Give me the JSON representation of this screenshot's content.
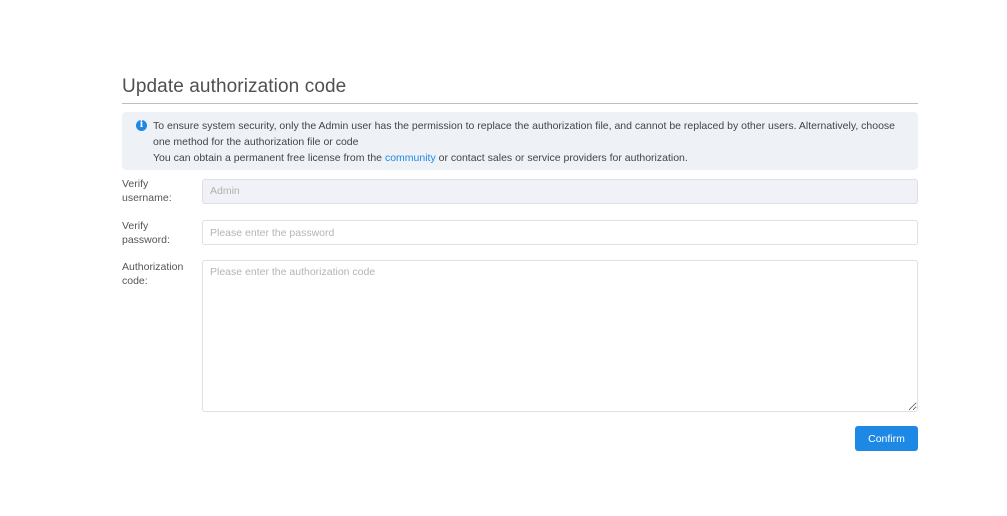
{
  "page": {
    "title": "Update authorization code"
  },
  "notice": {
    "icon": "info-icon",
    "line1": "To ensure system security, only the Admin user has the permission to replace the authorization file, and cannot be replaced by other users. Alternatively, choose one method for the authorization file or code",
    "line2_before": "You can obtain a permanent free license from the ",
    "line2_link": "community",
    "line2_after": " or contact sales or service providers for authorization.",
    "background": "#eef1f6",
    "icon_color": "#1e88e5"
  },
  "form": {
    "username": {
      "label": "Verify username:",
      "value": "Admin"
    },
    "password": {
      "label": "Verify password:",
      "placeholder": "Please enter the password"
    },
    "auth_code": {
      "label": "Authorization code:",
      "placeholder": "Please enter the authorization code"
    },
    "confirm_label": "Confirm"
  },
  "colors": {
    "accent": "#1e88e5"
  }
}
